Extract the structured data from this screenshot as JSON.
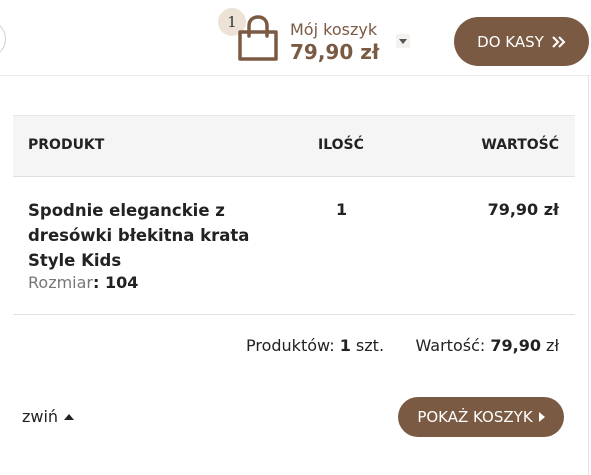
{
  "header": {
    "cart_count": "1",
    "cart_label": "Mój koszyk",
    "cart_total": "79,90 zł",
    "checkout_label": "DO KASY",
    "icons": {
      "bag": "shopping-bag-icon",
      "dropdown": "caret-down-icon",
      "chevrons": "double-chevron-right-icon"
    }
  },
  "table": {
    "headers": {
      "product": "PRODUKT",
      "quantity": "ILOŚĆ",
      "value": "WARTOŚĆ"
    },
    "rows": [
      {
        "name": "Spodnie eleganckie z dresówki błekitna krata Style Kids",
        "size_label": "Rozmiar",
        "size_value": ": 104",
        "quantity": "1",
        "value": "79,90 zł"
      }
    ]
  },
  "summary": {
    "products_label": "Produktów: ",
    "products_count": "1",
    "products_unit": " szt.",
    "value_label": "Wartość: ",
    "value_amount": "79,90",
    "value_currency": " zł"
  },
  "footer": {
    "collapse_label": "zwiń",
    "show_cart_label": "POKAŻ KOSZYK"
  },
  "colors": {
    "brand": "#7b5a43",
    "badge": "#ece3d6",
    "header_bg": "#f5f5f5"
  }
}
